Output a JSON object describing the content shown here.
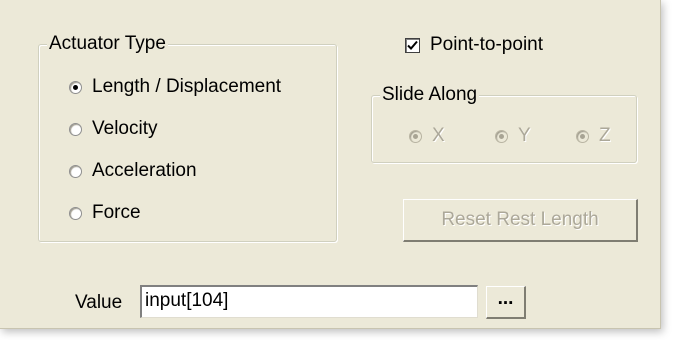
{
  "actuator_type": {
    "title": "Actuator Type",
    "options": [
      {
        "label": "Length / Displacement",
        "checked": true
      },
      {
        "label": "Velocity",
        "checked": false
      },
      {
        "label": "Acceleration",
        "checked": false
      },
      {
        "label": "Force",
        "checked": false
      }
    ]
  },
  "point_to_point": {
    "label": "Point-to-point",
    "checked": true
  },
  "slide_along": {
    "title": "Slide Along",
    "options": [
      {
        "label": "X",
        "checked": true,
        "enabled": false
      },
      {
        "label": "Y",
        "checked": true,
        "enabled": false
      },
      {
        "label": "Z",
        "checked": true,
        "enabled": false
      }
    ]
  },
  "reset_button": {
    "label": "Reset Rest Length",
    "enabled": false
  },
  "value": {
    "label": "Value",
    "input": "input[104]",
    "browse_label": "..."
  },
  "colors": {
    "background": "#ece9d8",
    "disabled_text": "#aca899"
  }
}
